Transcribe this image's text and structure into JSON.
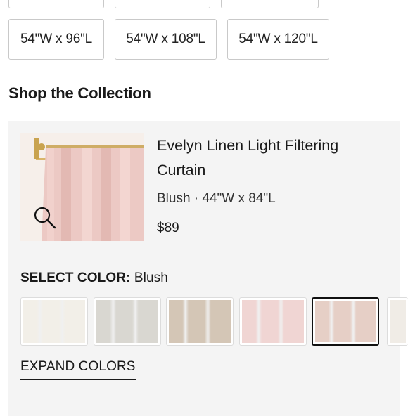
{
  "size_options_top_row": [
    "",
    "",
    ""
  ],
  "size_options": [
    "54\"W x 96\"L",
    "54\"W x 108\"L",
    "54\"W x 120\"L"
  ],
  "section": {
    "title": "Shop the Collection"
  },
  "product": {
    "name": "Evelyn Linen Light Filtering Curtain",
    "meta": "Blush · 44\"W x 84\"L",
    "price": "$89",
    "image_icon": "search-icon"
  },
  "color_selector": {
    "label": "SELECT COLOR:",
    "selected": "Blush",
    "swatches": [
      {
        "color": "#f2efe8",
        "selected": false
      },
      {
        "color": "#d9d7d1",
        "selected": false
      },
      {
        "color": "#d4c6b6",
        "selected": false
      },
      {
        "color": "#f0d5d3",
        "selected": false
      },
      {
        "color": "#e6cfc6",
        "selected": true
      }
    ],
    "expand_label": "EXPAND COLORS"
  }
}
